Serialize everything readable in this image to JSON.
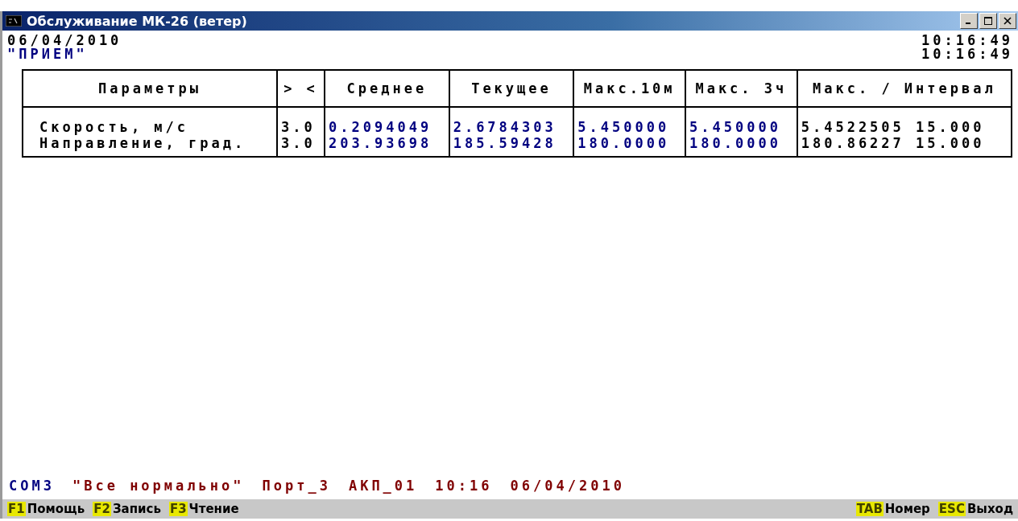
{
  "window": {
    "title": "Обслуживание МК-26 (ветер)"
  },
  "header": {
    "date": "06/04/2010",
    "mode": "\"ПРИЕМ\"",
    "time_1": "10:16:49",
    "time_2": "10:16:49"
  },
  "table": {
    "columns": [
      {
        "label": "Параметры",
        "kind": "name"
      },
      {
        "label": "> <",
        "kind": "threshold"
      },
      {
        "label": "Среднее",
        "kind": "value"
      },
      {
        "label": "Текущее",
        "kind": "value"
      },
      {
        "label": "Макс.10м",
        "kind": "value"
      },
      {
        "label": "Макс. 3ч",
        "kind": "value"
      },
      {
        "label": "Макс. / Интервал",
        "kind": "result"
      }
    ],
    "rows": [
      {
        "cells": [
          "Скорость, м/с",
          "3.0",
          "0.2094049",
          "2.6784303",
          "5.450000",
          "5.450000",
          "5.4522505 15.000"
        ]
      },
      {
        "cells": [
          "Направление, град.",
          "3.0",
          "203.93698",
          "185.59428",
          "180.0000",
          "180.0000",
          "180.86227 15.000"
        ]
      }
    ]
  },
  "status_line": [
    {
      "text": "COM3",
      "color": "#000080"
    },
    {
      "text": "\"Все нормально\"",
      "color": "#800000"
    },
    {
      "text": "Порт_3",
      "color": "#800000"
    },
    {
      "text": "АКП_01",
      "color": "#800000"
    },
    {
      "text": "10:16",
      "color": "#800000"
    },
    {
      "text": "06/04/2010",
      "color": "#800000"
    }
  ],
  "function_keys": {
    "left": [
      {
        "key": "F1",
        "label": "Помощь"
      },
      {
        "key": "F2",
        "label": "Запись"
      },
      {
        "key": "F3",
        "label": "Чтение"
      }
    ],
    "right": [
      {
        "key": "TAB",
        "label": "Номер"
      },
      {
        "key": "ESC",
        "label": "Выход"
      }
    ]
  }
}
